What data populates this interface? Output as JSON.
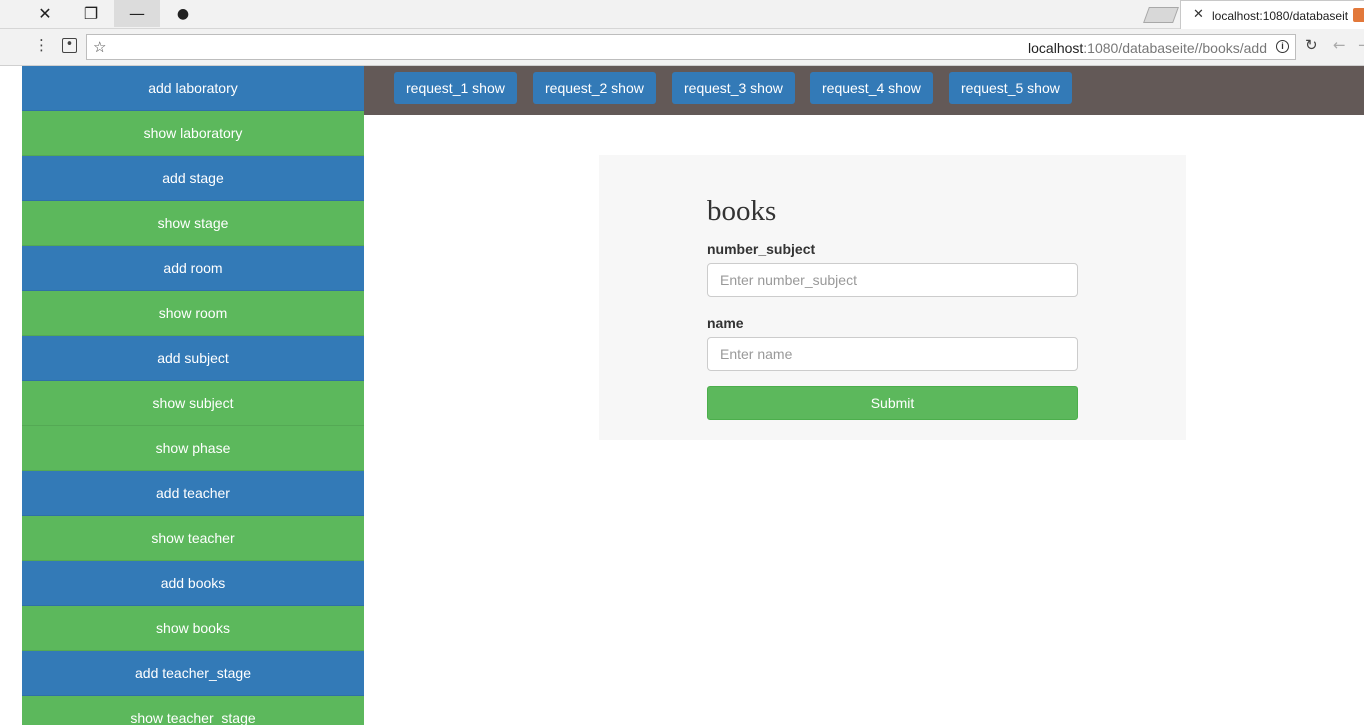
{
  "browser": {
    "window_controls": {
      "close": "✕",
      "restore": "❐",
      "minimize": "—",
      "profile": "●"
    },
    "tab": {
      "title": "localhost:1080/databaseit",
      "close": "✕"
    },
    "url": {
      "host": "localhost",
      "path": ":1080/databaseite//books/add"
    },
    "info_symbol": "i"
  },
  "sidebar": {
    "items": [
      {
        "label": "add laboratory",
        "color": "blue"
      },
      {
        "label": "show laboratory",
        "color": "green"
      },
      {
        "label": "add stage",
        "color": "blue"
      },
      {
        "label": "show stage",
        "color": "green"
      },
      {
        "label": "add room",
        "color": "blue"
      },
      {
        "label": "show room",
        "color": "green"
      },
      {
        "label": "add subject",
        "color": "blue"
      },
      {
        "label": "show subject",
        "color": "green"
      },
      {
        "label": "show phase",
        "color": "green"
      },
      {
        "label": "add teacher",
        "color": "blue"
      },
      {
        "label": "show teacher",
        "color": "green"
      },
      {
        "label": "add books",
        "color": "blue"
      },
      {
        "label": "show books",
        "color": "green"
      },
      {
        "label": "add teacher_stage",
        "color": "blue"
      },
      {
        "label": "show teacher_stage",
        "color": "green"
      }
    ]
  },
  "topnav": {
    "buttons": [
      "request_1 show",
      "request_2 show",
      "request_3 show",
      "request_4 show",
      "request_5 show"
    ]
  },
  "form": {
    "title": "books",
    "fields": [
      {
        "label": "number_subject",
        "placeholder": "Enter number_subject",
        "value": ""
      },
      {
        "label": "name",
        "placeholder": "Enter name",
        "value": ""
      }
    ],
    "submit_label": "Submit"
  },
  "colors": {
    "primary": "#337ab7",
    "success": "#5cb85c",
    "navbar": "#635957",
    "panel": "#f7f7f7"
  }
}
